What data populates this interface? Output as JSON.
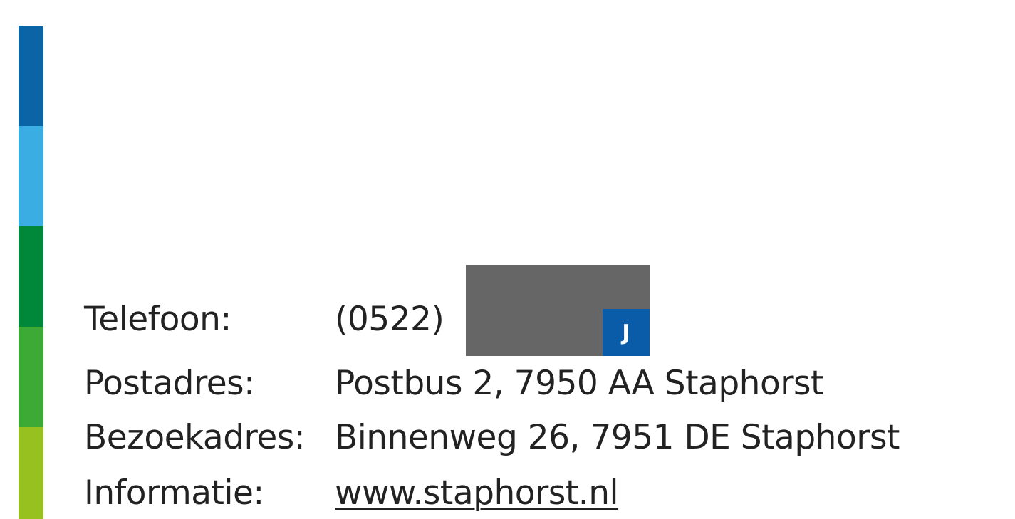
{
  "brand": {
    "stripe_colors": [
      "#0a64a6",
      "#3aaee2",
      "#00883a",
      "#3daa35",
      "#97c11f"
    ]
  },
  "contact": {
    "phone": {
      "label": "Telefoon:",
      "value": "(0522)",
      "redaction_badge": "J"
    },
    "postal": {
      "label": "Postadres:",
      "value": "Postbus 2, 7950 AA Staphorst"
    },
    "visit": {
      "label": "Bezoekadres:",
      "value": "Binnenweg 26, 7951 DE Staphorst"
    },
    "info": {
      "label": "Informatie:",
      "value": "www.staphorst.nl"
    }
  }
}
